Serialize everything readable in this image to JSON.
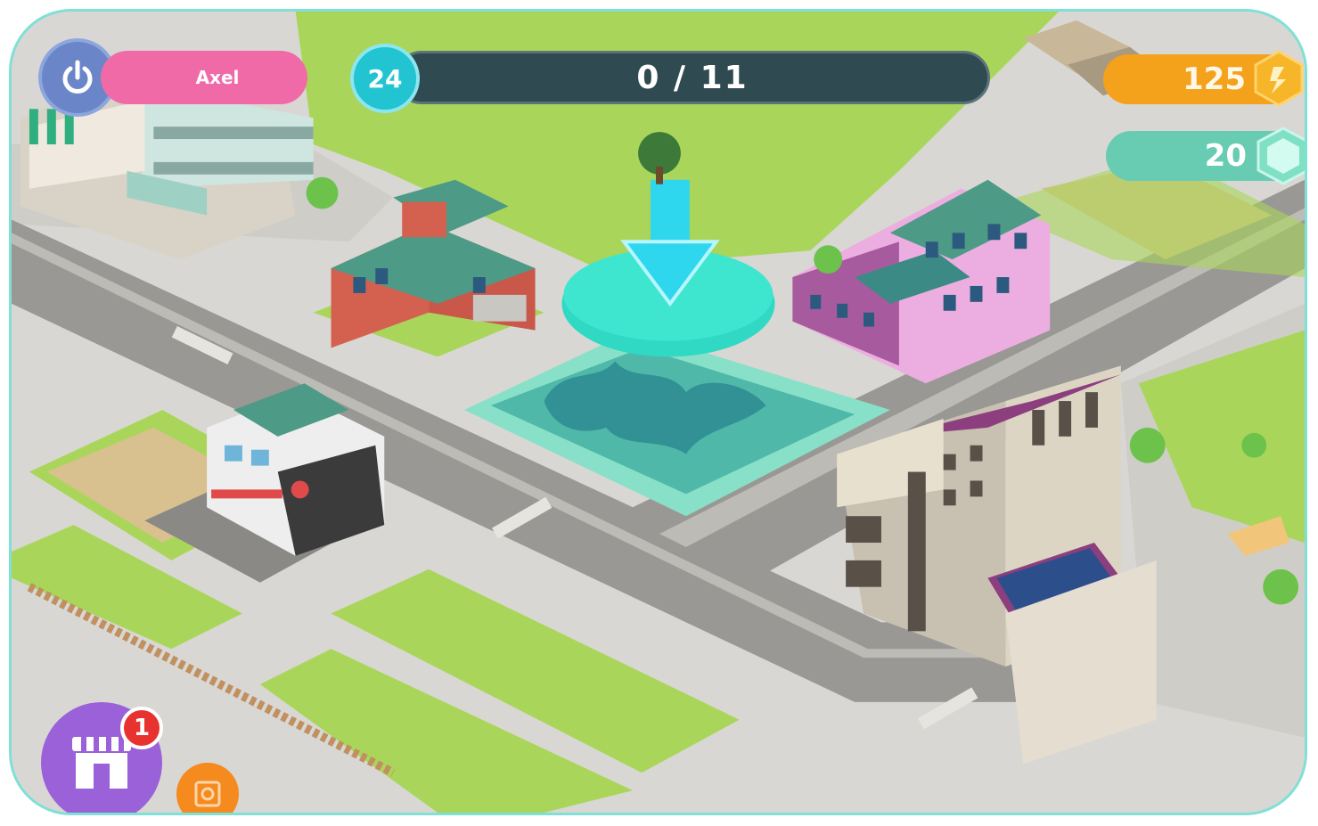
{
  "player": {
    "name": "Axel"
  },
  "level": {
    "number": "24"
  },
  "progress": {
    "current": 0,
    "total": 11,
    "label": "0 / 11",
    "fraction": 0
  },
  "currency": {
    "coins": "125",
    "gems": "20"
  },
  "shop": {
    "badge_count": "1"
  },
  "icons": {
    "power": "power-icon",
    "coin": "coin-icon",
    "gem": "gem-icon",
    "shop": "shop-icon",
    "photo": "photo-icon",
    "arrow": "down-arrow-icon"
  },
  "colors": {
    "power": "#6b86c8",
    "player": "#f06aa8",
    "level": "#21c4d0",
    "progress_track": "#2f4a50",
    "coins": "#f4a11c",
    "gems": "#67ccb2",
    "shop": "#9b61d9",
    "badge": "#e8322f",
    "photo": "#f58a1f",
    "highlight": "#26e0d0"
  }
}
